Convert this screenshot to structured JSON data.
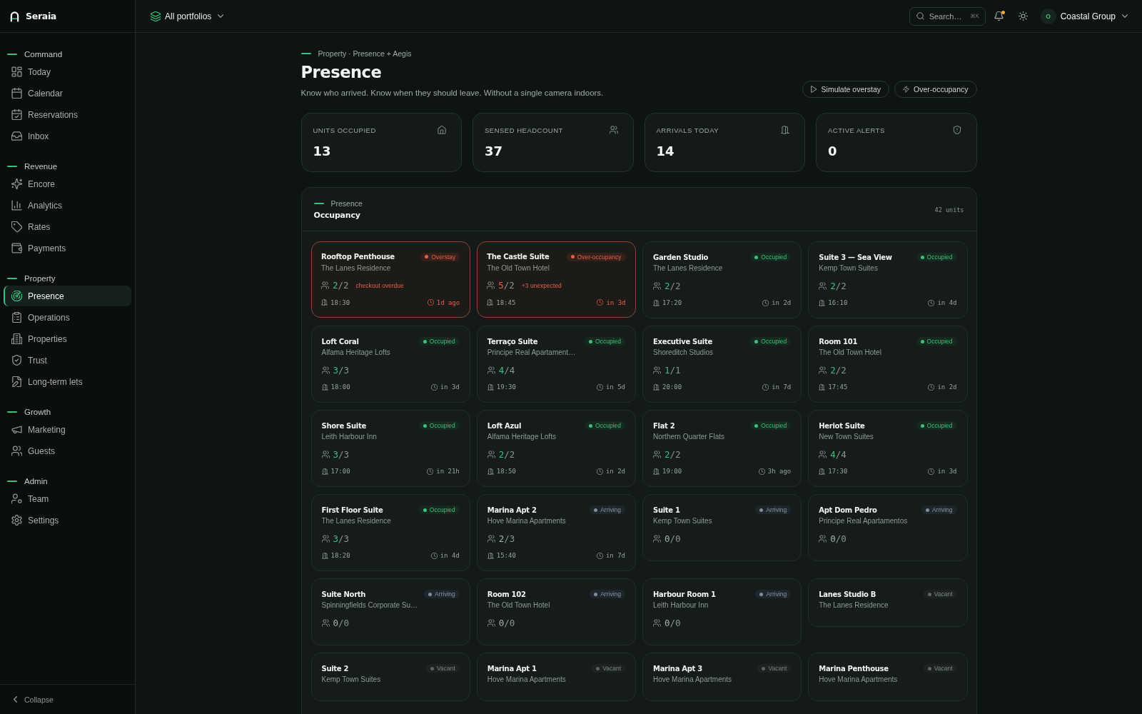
{
  "app": {
    "name": "Seraia"
  },
  "sidebar": {
    "sections": [
      {
        "label": "Command",
        "items": [
          {
            "label": "Today",
            "selected": false
          },
          {
            "label": "Calendar",
            "selected": false
          },
          {
            "label": "Reservations",
            "selected": false
          },
          {
            "label": "Inbox",
            "selected": false
          }
        ]
      },
      {
        "label": "Revenue",
        "items": [
          {
            "label": "Encore",
            "selected": false
          },
          {
            "label": "Analytics",
            "selected": false
          },
          {
            "label": "Rates",
            "selected": false
          },
          {
            "label": "Payments",
            "selected": false
          }
        ]
      },
      {
        "label": "Property",
        "items": [
          {
            "label": "Presence",
            "selected": true
          },
          {
            "label": "Operations",
            "selected": false
          },
          {
            "label": "Properties",
            "selected": false
          },
          {
            "label": "Trust",
            "selected": false
          },
          {
            "label": "Long-term lets",
            "selected": false
          }
        ]
      },
      {
        "label": "Growth",
        "items": [
          {
            "label": "Marketing",
            "selected": false
          },
          {
            "label": "Guests",
            "selected": false
          }
        ]
      },
      {
        "label": "Admin",
        "items": [
          {
            "label": "Team",
            "selected": false
          },
          {
            "label": "Settings",
            "selected": false
          }
        ]
      }
    ],
    "collapse": "Collapse"
  },
  "header": {
    "portfolio": "All portfolios",
    "search": {
      "placeholder": "Search…",
      "shortcut": "⌘K"
    },
    "unread_notifications": true,
    "account": {
      "initial": "O",
      "name": "Coastal Group"
    }
  },
  "page": {
    "breadcrumb": "Property · Presence + Aegis",
    "title": "Presence",
    "subtitle": "Know who arrived. Know when they should leave. Without a single camera indoors.",
    "actions": [
      "Simulate overstay",
      "Over-occupancy"
    ]
  },
  "stats": [
    {
      "label": "UNITS OCCUPIED",
      "value": "13"
    },
    {
      "label": "SENSED HEADCOUNT",
      "value": "37"
    },
    {
      "label": "ARRIVALS TODAY",
      "value": "14"
    },
    {
      "label": "ACTIVE ALERTS",
      "value": "0"
    }
  ],
  "occupancy": {
    "eyebrow": "Presence",
    "title": "Occupancy",
    "count": "42 units",
    "units": [
      {
        "name": "Rooftop Penthouse",
        "location": "The Lanes Residence",
        "kind": "overstay",
        "status": "Overstay",
        "color": "#e5604a",
        "sensed": "2",
        "capacity": "/2",
        "note": "checkout overdue",
        "arrival": "18:30",
        "departure": "1d ago"
      },
      {
        "name": "The Castle Suite",
        "location": "The Old Town Hotel",
        "kind": "over_occupancy",
        "status": "Over-occupancy",
        "color": "#e5604a",
        "sensed": "5",
        "capacity": "/2",
        "note": "+3 unexpected",
        "arrival": "18:45",
        "departure": "in 3d"
      },
      {
        "name": "Garden Studio",
        "location": "The Lanes Residence",
        "kind": "occupied",
        "status": "Occupied",
        "color": "#3fbf7f",
        "sensed": "2",
        "capacity": "/2",
        "arrival": "17:20",
        "departure": "in 2d"
      },
      {
        "name": "Suite 3 — Sea View",
        "location": "Kemp Town Suites",
        "kind": "occupied",
        "status": "Occupied",
        "color": "#3fbf7f",
        "sensed": "2",
        "capacity": "/2",
        "arrival": "16:10",
        "departure": "in 4d"
      },
      {
        "name": "Loft Coral",
        "location": "Alfama Heritage Lofts",
        "kind": "occupied",
        "status": "Occupied",
        "color": "#3fbf7f",
        "sensed": "3",
        "capacity": "/3",
        "arrival": "18:00",
        "departure": "in 3d"
      },
      {
        "name": "Terraço Suite",
        "location": "Principe Real Apartament…",
        "kind": "occupied",
        "status": "Occupied",
        "color": "#3fbf7f",
        "sensed": "4",
        "capacity": "/4",
        "arrival": "19:30",
        "departure": "in 5d"
      },
      {
        "name": "Executive Suite",
        "location": "Shoreditch Studios",
        "kind": "occupied",
        "status": "Occupied",
        "color": "#3fbf7f",
        "sensed": "1",
        "capacity": "/1",
        "arrival": "20:00",
        "departure": "in 7d"
      },
      {
        "name": "Room 101",
        "location": "The Old Town Hotel",
        "kind": "occupied",
        "status": "Occupied",
        "color": "#3fbf7f",
        "sensed": "2",
        "capacity": "/2",
        "arrival": "17:45",
        "departure": "in 2d"
      },
      {
        "name": "Shore Suite",
        "location": "Leith Harbour Inn",
        "kind": "occupied",
        "status": "Occupied",
        "color": "#3fbf7f",
        "sensed": "3",
        "capacity": "/3",
        "arrival": "17:00",
        "departure": "in 21h"
      },
      {
        "name": "Loft Azul",
        "location": "Alfama Heritage Lofts",
        "kind": "occupied",
        "status": "Occupied",
        "color": "#3fbf7f",
        "sensed": "2",
        "capacity": "/2",
        "arrival": "18:50",
        "departure": "in 2d"
      },
      {
        "name": "Flat 2",
        "location": "Northern Quarter Flats",
        "kind": "occupied",
        "status": "Occupied",
        "color": "#3fbf7f",
        "sensed": "2",
        "capacity": "/2",
        "arrival": "19:00",
        "departure": "3h ago"
      },
      {
        "name": "Heriot Suite",
        "location": "New Town Suites",
        "kind": "occupied",
        "status": "Occupied",
        "color": "#3fbf7f",
        "sensed": "4",
        "capacity": "/4",
        "arrival": "17:30",
        "departure": "in 3d"
      },
      {
        "name": "First Floor Suite",
        "location": "The Lanes Residence",
        "kind": "occupied",
        "status": "Occupied",
        "color": "#3fbf7f",
        "sensed": "3",
        "capacity": "/3",
        "arrival": "18:20",
        "departure": "in 4d"
      },
      {
        "name": "Marina Apt 2",
        "location": "Hove Marina Apartments",
        "kind": "arriving",
        "status": "Arriving",
        "color": "#7f8d99",
        "sensed": "2",
        "capacity": "/3",
        "arrival": "15:40",
        "departure": "in 7d"
      },
      {
        "name": "Suite 1",
        "location": "Kemp Town Suites",
        "kind": "arriving",
        "status": "Arriving",
        "color": "#7f8d99",
        "sensed": "0",
        "capacity": "/0"
      },
      {
        "name": "Apt Dom Pedro",
        "location": "Principe Real Apartamentos",
        "kind": "arriving",
        "status": "Arriving",
        "color": "#7f8d99",
        "sensed": "0",
        "capacity": "/0"
      },
      {
        "name": "Suite North",
        "location": "Spinningfields Corporate Su…",
        "kind": "arriving",
        "status": "Arriving",
        "color": "#7f8d99",
        "sensed": "0",
        "capacity": "/0"
      },
      {
        "name": "Room 102",
        "location": "The Old Town Hotel",
        "kind": "arriving",
        "status": "Arriving",
        "color": "#7f8d99",
        "sensed": "0",
        "capacity": "/0"
      },
      {
        "name": "Harbour Room 1",
        "location": "Leith Harbour Inn",
        "kind": "arriving",
        "status": "Arriving",
        "color": "#7f8d99",
        "sensed": "0",
        "capacity": "/0"
      },
      {
        "name": "Lanes Studio B",
        "location": "The Lanes Residence",
        "kind": "vacant",
        "status": "Vacant",
        "color": "#5b6561"
      },
      {
        "name": "Suite 2",
        "location": "Kemp Town Suites",
        "kind": "vacant",
        "status": "Vacant",
        "color": "#5b6561"
      },
      {
        "name": "Marina Apt 1",
        "location": "Hove Marina Apartments",
        "kind": "vacant",
        "status": "Vacant",
        "color": "#5b6561"
      },
      {
        "name": "Marina Apt 3",
        "location": "Hove Marina Apartments",
        "kind": "vacant",
        "status": "Vacant",
        "color": "#5b6561"
      },
      {
        "name": "Marina Penthouse",
        "location": "Hove Marina Apartments",
        "kind": "vacant",
        "status": "Vacant",
        "color": "#5b6561"
      }
    ]
  }
}
